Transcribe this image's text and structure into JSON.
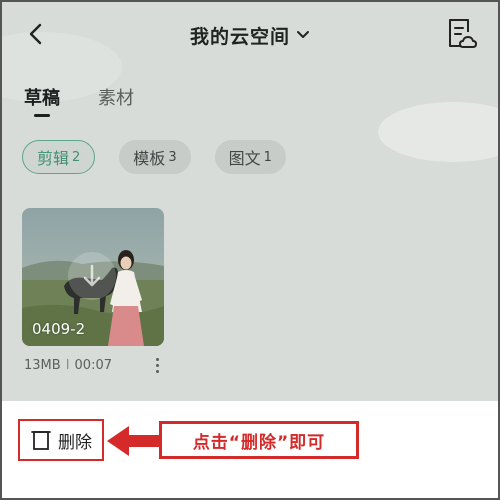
{
  "header": {
    "title": "我的云空间",
    "back_icon": "chevron-left-icon",
    "dropdown_icon": "chevron-down-icon",
    "drafts_icon": "cloud-drafts-icon"
  },
  "tabs": [
    {
      "label": "草稿",
      "active": true
    },
    {
      "label": "素材",
      "active": false
    }
  ],
  "filters": [
    {
      "label": "剪辑",
      "count": "2",
      "active": true
    },
    {
      "label": "模板",
      "count": "3",
      "active": false
    },
    {
      "label": "图文",
      "count": "1",
      "active": false
    }
  ],
  "draft_item": {
    "name": "0409-2",
    "size": "13MB",
    "separator": "I",
    "duration": "00:07",
    "more_icon": "more-vertical-icon"
  },
  "action_bar": {
    "delete_label": "删除",
    "delete_icon": "trash-icon"
  },
  "annotation": {
    "text": "点击“删除”即可",
    "arrow_icon": "arrow-left-icon",
    "color": "#d42a2a"
  },
  "colors": {
    "accent": "#3f8f70",
    "highlight": "#d42a2a"
  }
}
